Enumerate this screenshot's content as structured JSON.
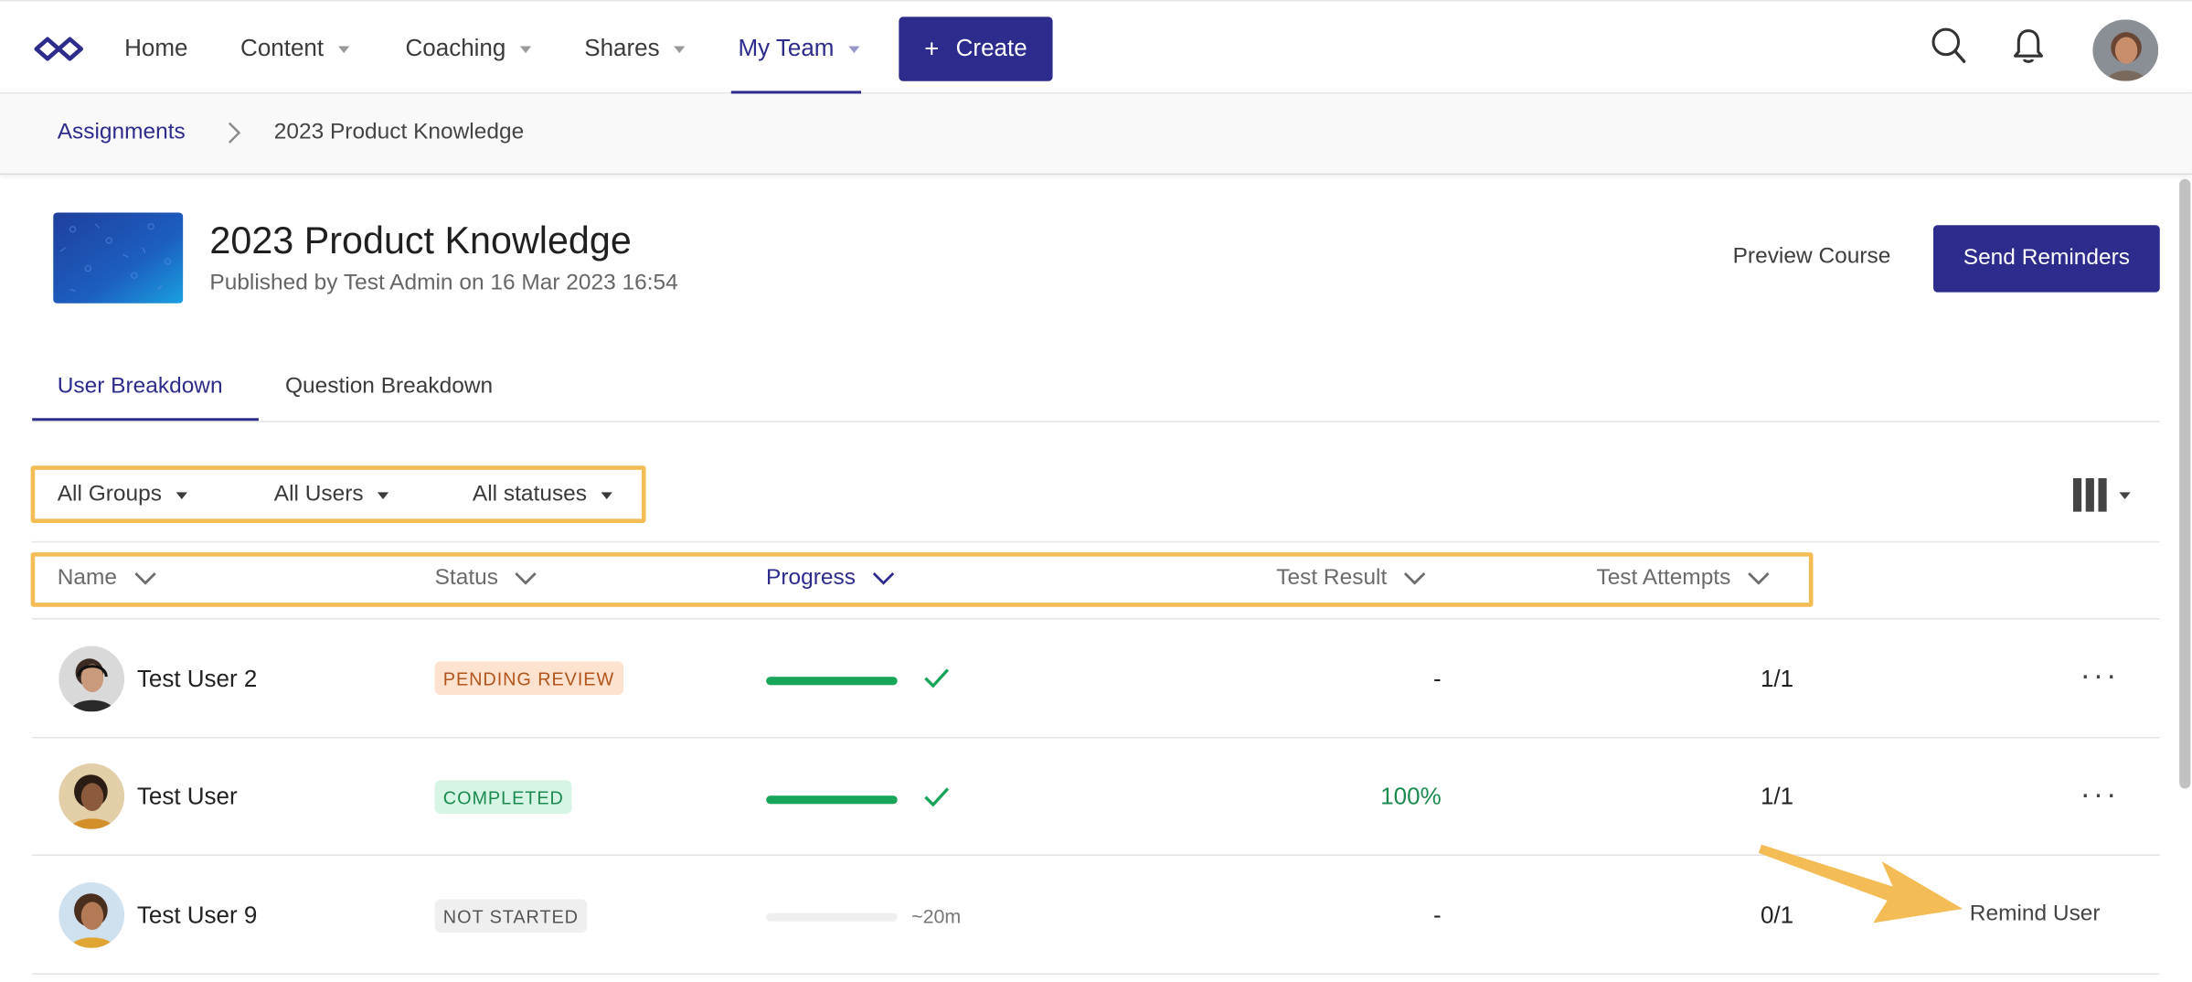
{
  "nav": {
    "items": [
      {
        "label": "Home",
        "dropdown": false
      },
      {
        "label": "Content",
        "dropdown": true
      },
      {
        "label": "Coaching",
        "dropdown": true
      },
      {
        "label": "Shares",
        "dropdown": true
      },
      {
        "label": "My Team",
        "dropdown": true,
        "active": true
      }
    ],
    "create_label": "Create",
    "icons": [
      "infinity-logo-icon",
      "search-icon",
      "bell-icon",
      "avatar"
    ]
  },
  "breadcrumb": {
    "parent": "Assignments",
    "current": "2023 Product Knowledge"
  },
  "header": {
    "title": "2023 Product Knowledge",
    "subtitle": "Published by Test Admin on 16 Mar 2023 16:54",
    "preview_label": "Preview Course",
    "send_label": "Send Reminders"
  },
  "tabs": [
    {
      "label": "User Breakdown",
      "active": true
    },
    {
      "label": "Question Breakdown",
      "active": false
    }
  ],
  "filters": {
    "groups": "All Groups",
    "users": "All Users",
    "statuses": "All statuses"
  },
  "table": {
    "columns": {
      "name": "Name",
      "status": "Status",
      "progress": "Progress",
      "result": "Test Result",
      "attempts": "Test Attempts"
    },
    "rows": [
      {
        "name": "Test User 2",
        "status": "PENDING REVIEW",
        "progress": 1.0,
        "result": "-",
        "attempts": "1/1",
        "action": "more"
      },
      {
        "name": "Test User",
        "status": "COMPLETED",
        "progress": 1.0,
        "result": "100%",
        "attempts": "1/1",
        "action": "more"
      },
      {
        "name": "Test User 9",
        "status": "NOT STARTED",
        "progress": 0.0,
        "eta": "~20m",
        "result": "-",
        "attempts": "0/1",
        "action": "Remind User"
      }
    ]
  },
  "colors": {
    "brand": "#2d2b8c",
    "highlight": "#f3bc54",
    "success": "#17a55a",
    "pending_bg": "#fde3cf",
    "completed_bg": "#d7f5e5"
  }
}
